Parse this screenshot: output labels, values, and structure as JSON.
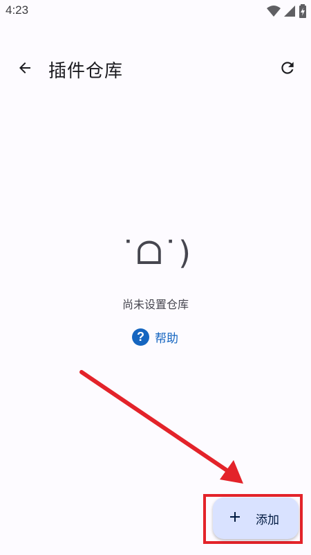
{
  "status_bar": {
    "time": "4:23",
    "icons": [
      "wifi-icon",
      "signal-icon",
      "battery-icon"
    ]
  },
  "header": {
    "title": "插件仓库",
    "back_icon": "arrow-back-icon",
    "refresh_icon": "refresh-icon"
  },
  "empty_state": {
    "face": "˙ᗝ˙)",
    "message": "尚未设置仓库",
    "help_label": "帮助",
    "help_icon": "help-circle-icon"
  },
  "fab": {
    "label": "添加",
    "icon": "plus-icon"
  },
  "colors": {
    "background": "#fdfbff",
    "primary": "#1565c0",
    "fab_container": "#d9e2ff",
    "annotation": "#e3232a"
  }
}
